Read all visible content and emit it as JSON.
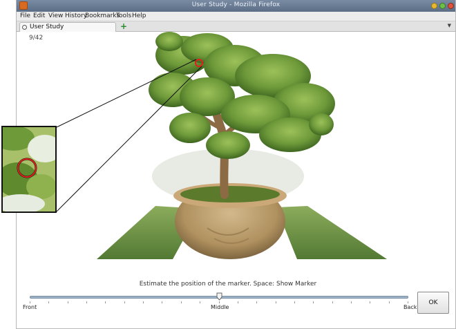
{
  "window": {
    "title": "User Study - Mozilla Firefox"
  },
  "menu": {
    "items": [
      "File",
      "Edit",
      "View",
      "History",
      "Bookmarks",
      "Tools",
      "Help"
    ]
  },
  "tab": {
    "label": "User Study",
    "new_tab_symbol": "+"
  },
  "study": {
    "counter": "9/42",
    "instruction": "Estimate the position of the marker. Space: Show Marker",
    "slider": {
      "left_label": "Front",
      "middle_label": "Middle",
      "right_label": "Back",
      "value": 0.5
    },
    "ok_label": "OK"
  },
  "colors": {
    "marker": "#e0201a",
    "slider_track": "#9eb4c9",
    "foliage": "#6f9a3a",
    "pot": "#b89a6a",
    "ground": "#5f8a2e"
  },
  "icons": {
    "app": "firefox-icon",
    "favicon": "page-icon",
    "new_tab": "plus-icon",
    "minimize": "minimize-icon",
    "maximize": "maximize-icon",
    "close": "close-icon"
  }
}
